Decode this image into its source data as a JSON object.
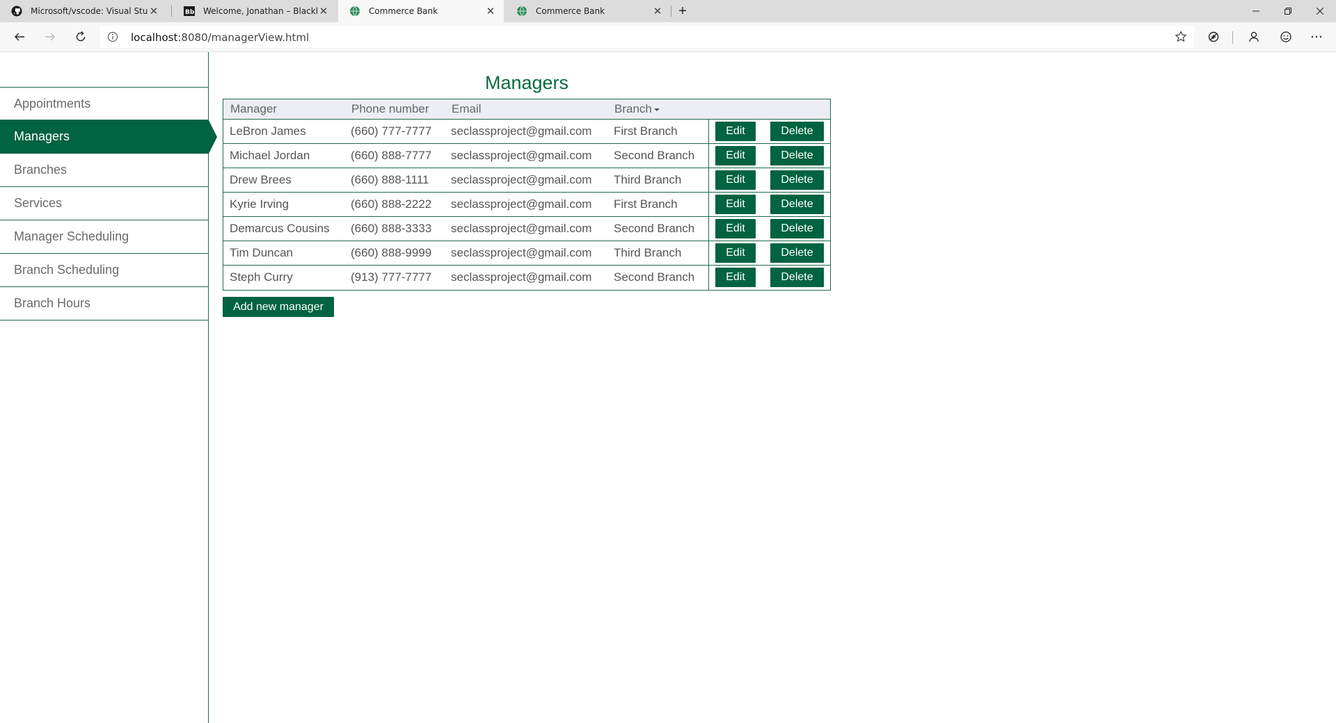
{
  "browser": {
    "tabs": [
      {
        "title": "Microsoft/vscode: Visual Studio C",
        "icon": "github-icon",
        "active": false
      },
      {
        "title": "Welcome, Jonathan – Blackboard",
        "icon": "blackboard-icon",
        "active": false
      },
      {
        "title": "Commerce Bank",
        "icon": "globe-icon",
        "active": true
      },
      {
        "title": "Commerce Bank",
        "icon": "globe-icon",
        "active": false
      }
    ],
    "close_glyph": "✕",
    "new_tab_glyph": "+",
    "address": {
      "host": "localhost",
      "path": ":8080/managerView.html"
    }
  },
  "sidebar": {
    "items": [
      {
        "label": "Appointments"
      },
      {
        "label": "Managers",
        "active": true
      },
      {
        "label": "Branches"
      },
      {
        "label": "Services"
      },
      {
        "label": "Manager Scheduling"
      },
      {
        "label": "Branch Scheduling"
      },
      {
        "label": "Branch Hours"
      }
    ]
  },
  "main": {
    "title": "Managers",
    "columns": [
      "Manager",
      "Phone number",
      "Email",
      "Branch"
    ],
    "rows": [
      {
        "name": "LeBron James",
        "phone": "(660) 777-7777",
        "email": "seclassproject@gmail.com",
        "branch": "First Branch"
      },
      {
        "name": "Michael Jordan",
        "phone": "(660) 888-7777",
        "email": "seclassproject@gmail.com",
        "branch": "Second Branch"
      },
      {
        "name": "Drew Brees",
        "phone": "(660) 888-1111",
        "email": "seclassproject@gmail.com",
        "branch": "Third Branch"
      },
      {
        "name": "Kyrie Irving",
        "phone": "(660) 888-2222",
        "email": "seclassproject@gmail.com",
        "branch": "First Branch"
      },
      {
        "name": "Demarcus Cousins",
        "phone": "(660) 888-3333",
        "email": "seclassproject@gmail.com",
        "branch": "Second Branch"
      },
      {
        "name": "Tim Duncan",
        "phone": "(660) 888-9999",
        "email": "seclassproject@gmail.com",
        "branch": "Third Branch"
      },
      {
        "name": "Steph Curry",
        "phone": "(913) 777-7777",
        "email": "seclassproject@gmail.com",
        "branch": "Second Branch"
      }
    ],
    "edit_label": "Edit",
    "delete_label": "Delete",
    "add_label": "Add new manager"
  },
  "colors": {
    "accent": "#006341",
    "title": "#0a6b3c",
    "header_bg": "#eceef3"
  }
}
